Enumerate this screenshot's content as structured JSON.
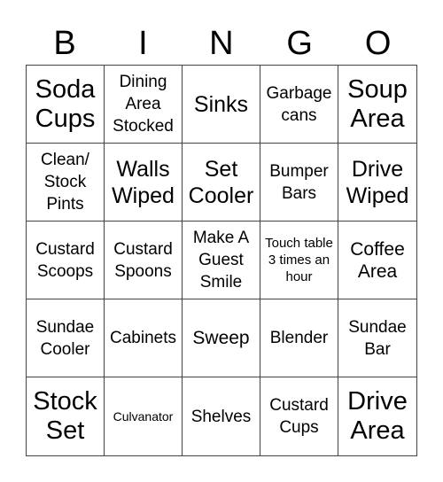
{
  "header": [
    "B",
    "I",
    "N",
    "G",
    "O"
  ],
  "grid": [
    [
      {
        "text": "Soda Cups",
        "size": "xl"
      },
      {
        "text": "Dining Area Stocked",
        "size": "s"
      },
      {
        "text": "Sinks",
        "size": "l"
      },
      {
        "text": "Garbage cans",
        "size": "s"
      },
      {
        "text": "Soup Area",
        "size": "xl"
      }
    ],
    [
      {
        "text": "Clean/ Stock Pints",
        "size": "s"
      },
      {
        "text": "Walls Wiped",
        "size": "l"
      },
      {
        "text": "Set Cooler",
        "size": "l"
      },
      {
        "text": "Bumper Bars",
        "size": "s"
      },
      {
        "text": "Drive Wiped",
        "size": "l"
      }
    ],
    [
      {
        "text": "Custard Scoops",
        "size": "s"
      },
      {
        "text": "Custard Spoons",
        "size": "s"
      },
      {
        "text": "Make A Guest Smile",
        "size": "s"
      },
      {
        "text": "Touch table 3 times an hour",
        "size": "xs"
      },
      {
        "text": "Coffee Area",
        "size": "m"
      }
    ],
    [
      {
        "text": "Sundae Cooler",
        "size": "s"
      },
      {
        "text": "Cabinets",
        "size": "s"
      },
      {
        "text": "Sweep",
        "size": "m"
      },
      {
        "text": "Blender",
        "size": "s"
      },
      {
        "text": "Sundae Bar",
        "size": "s"
      }
    ],
    [
      {
        "text": "Stock Set",
        "size": "xl"
      },
      {
        "text": "Culvanator",
        "size": "xxs"
      },
      {
        "text": "Shelves",
        "size": "s"
      },
      {
        "text": "Custard Cups",
        "size": "s"
      },
      {
        "text": "Drive Area",
        "size": "xl"
      }
    ]
  ]
}
